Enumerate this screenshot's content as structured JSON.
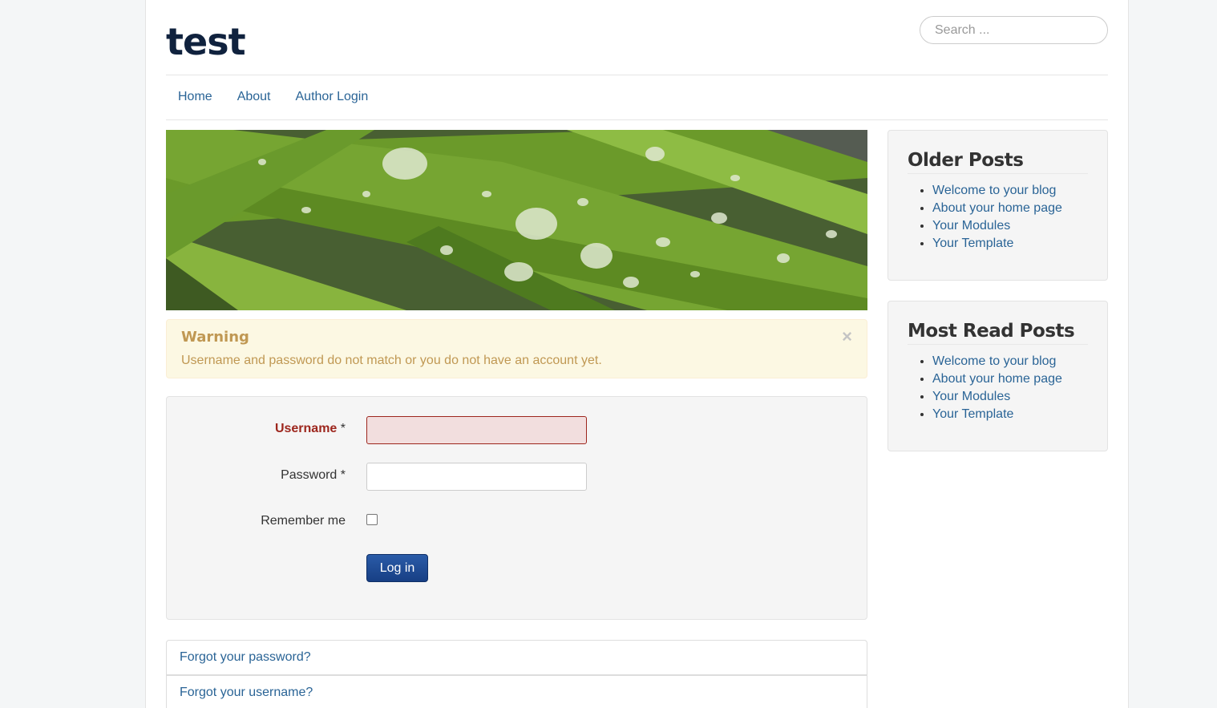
{
  "site": {
    "title": "test"
  },
  "search": {
    "placeholder": "Search ..."
  },
  "nav": {
    "items": [
      "Home",
      "About",
      "Author Login"
    ]
  },
  "alert": {
    "heading": "Warning",
    "message": "Username and password do not match or you do not have an account yet.",
    "close": "×"
  },
  "login": {
    "username_label": "Username",
    "password_label": "Password",
    "required_mark": "*",
    "remember_label": "Remember me",
    "submit_label": "Log in"
  },
  "links": {
    "forgot_password": "Forgot your password?",
    "forgot_username": "Forgot your username?"
  },
  "sidebar": {
    "older_posts": {
      "title": "Older Posts",
      "items": [
        "Welcome to your blog",
        "About your home page",
        "Your Modules",
        "Your Template"
      ]
    },
    "most_read": {
      "title": "Most Read Posts",
      "items": [
        "Welcome to your blog",
        "About your home page",
        "Your Modules",
        "Your Template"
      ]
    }
  },
  "colors": {
    "link": "#2a6496",
    "title": "#10223e",
    "warning_text": "#c09853",
    "warning_bg": "#fcf8e3",
    "error_label": "#9d261d",
    "button": "#1f4f9c"
  }
}
